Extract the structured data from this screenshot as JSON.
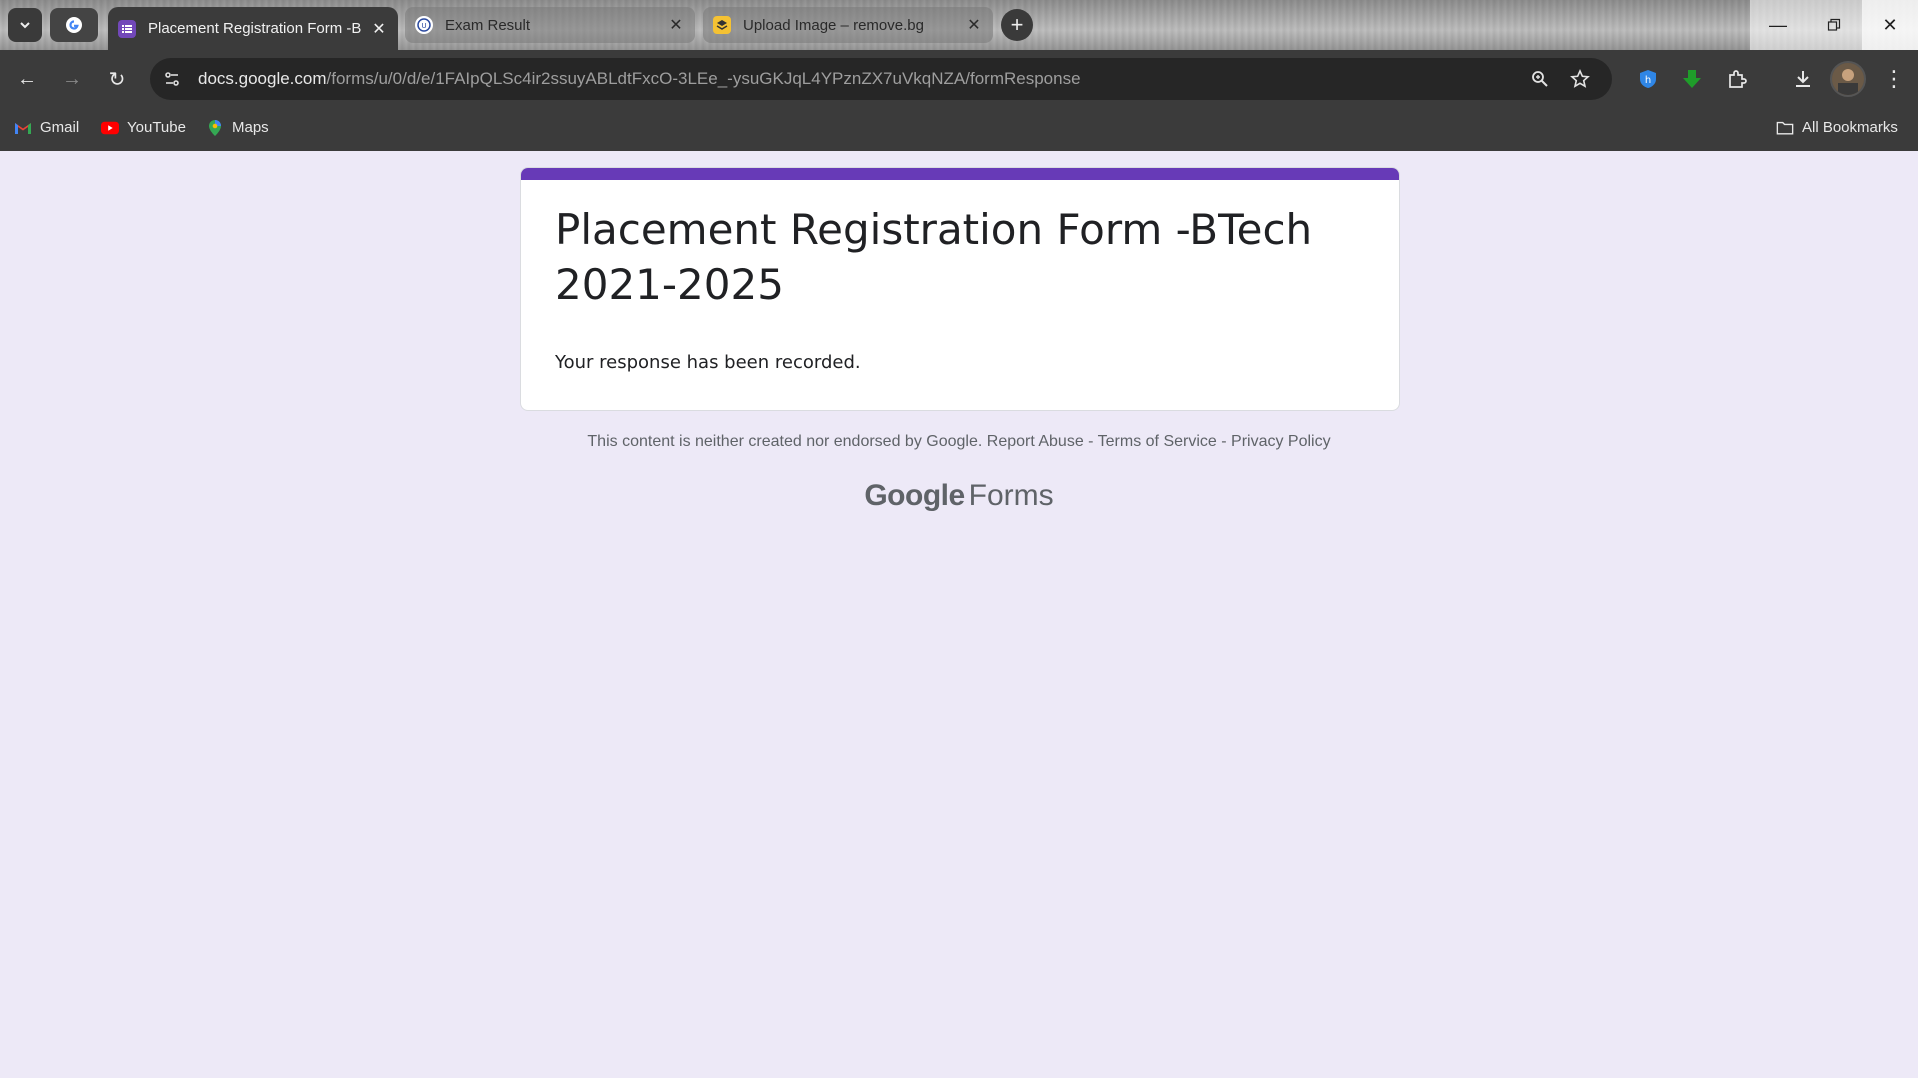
{
  "browser": {
    "tabs": [
      {
        "title": "Placement Registration Form -B",
        "active": true,
        "icon": "google-forms-icon"
      },
      {
        "title": "Exam Result",
        "active": false,
        "icon": "university-icon"
      },
      {
        "title": "Upload Image – remove.bg",
        "active": false,
        "icon": "removebg-icon"
      }
    ],
    "url": {
      "host": "docs.google.com",
      "path": "/forms/u/0/d/e/1FAIpQLSc4ir2ssuyABLdtFxcO-3LEe_-ysuGKJqL4YPznZX7uVkqNZA/formResponse"
    },
    "bookmarks": [
      {
        "label": "Gmail",
        "icon": "gmail-icon"
      },
      {
        "label": "YouTube",
        "icon": "youtube-icon"
      },
      {
        "label": "Maps",
        "icon": "maps-icon"
      }
    ],
    "all_bookmarks": "All Bookmarks",
    "colors": {
      "forms_accent": "#673ab7",
      "page_bg": "#ede9f7"
    }
  },
  "form": {
    "title": "Placement Registration Form -BTech 2021-2025",
    "confirmation": "Your response has been recorded."
  },
  "footer": {
    "disclaimer": "This content is neither created nor endorsed by Google.",
    "report_abuse": "Report Abuse",
    "sep1": " - ",
    "terms": "Terms of Service",
    "sep2": " - ",
    "privacy": "Privacy Policy",
    "brand_google": "Google",
    "brand_forms": "Forms"
  }
}
